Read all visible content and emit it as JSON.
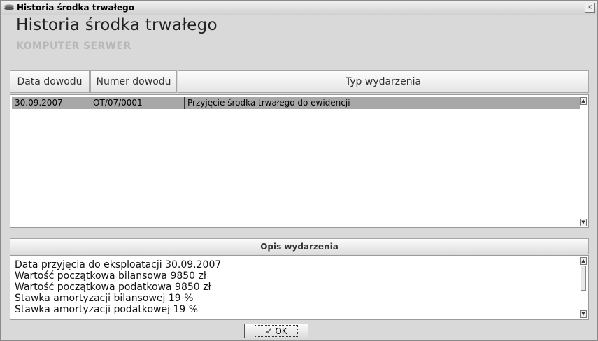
{
  "window": {
    "title": "Historia środka trwałego",
    "close_glyph": "×"
  },
  "heading": "Historia środka trwałego",
  "asset_name": "KOMPUTER SERWER",
  "events_table": {
    "columns": [
      "Data dowodu",
      "Numer dowodu",
      "Typ wydarzenia"
    ],
    "rows": [
      {
        "date": "30.09.2007",
        "number": "OT/07/0001",
        "type": "Przyjęcie środka trwałego do ewidencji",
        "selected": true
      }
    ]
  },
  "description": {
    "header": "Opis wydarzenia",
    "lines": [
      "Data przyjęcia do eksploatacji 30.09.2007",
      "Wartość początkowa bilansowa 9850 zł",
      "Wartość początkowa podatkowa 9850 zł",
      "Stawka amortyzacji bilansowej 19 %",
      "Stawka amortyzacji podatkowej 19 %"
    ]
  },
  "ok_button": {
    "label": "OK",
    "icon": "checkmark-icon"
  },
  "colors": {
    "selected_row": "#a8a8a8",
    "subhead": "#b8b8b8"
  }
}
